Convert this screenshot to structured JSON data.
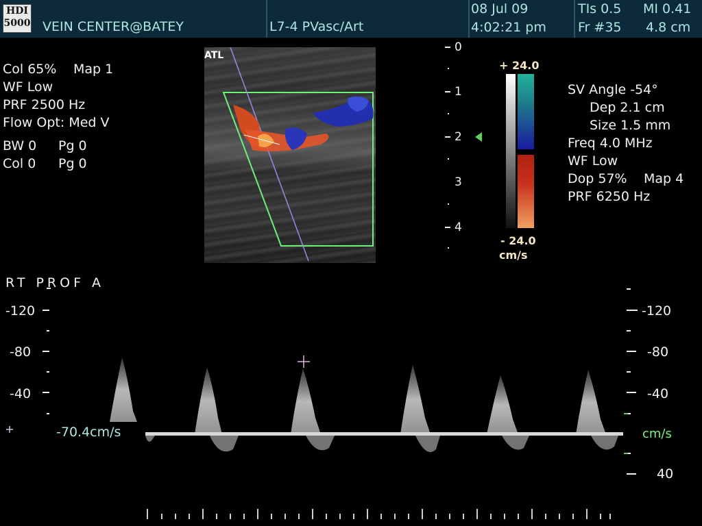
{
  "header": {
    "logo_line1": "HDI",
    "logo_line2": "5000",
    "facility": "VEIN CENTER@BATEY",
    "probe": "L7-4 PVasc/Art",
    "date": "08 Jul 09",
    "time": "4:02:21 pm",
    "tis": "TIs 0.5",
    "mi": "MI 0.41",
    "frame": "Fr #35",
    "depth": "4.8 cm"
  },
  "color_settings": {
    "col": "Col 65%",
    "map": "Map 1",
    "wf": "WF Low",
    "prf": "PRF 2500  Hz",
    "flow_opt": "Flow Opt: Med V",
    "bw": "BW 0",
    "pg1": "Pg 0",
    "col0": "Col 0",
    "pg2": "Pg 0"
  },
  "image": {
    "atl_label": "ATL"
  },
  "depth_scale": {
    "labels": [
      "0",
      "1",
      "2",
      "3",
      "4"
    ]
  },
  "color_bar": {
    "top": "+ 24.0",
    "bottom": "- 24.0",
    "unit": "cm/s",
    "colors": {
      "teal": "#22b39a",
      "blue": "#1a1aa0",
      "red": "#c8321e",
      "orange": "#f0a060"
    }
  },
  "doppler_settings": {
    "sv_angle": "SV Angle -54°",
    "dep": "Dep 2.1  cm",
    "size": "Size 1.5  mm",
    "freq": "Freq 4.0  MHz",
    "wf": "WF Low",
    "dop": "Dop 57%",
    "map": "Map 4",
    "prf": "PRF 6250  Hz"
  },
  "spectral": {
    "label": "RT  PROF  A",
    "left_scale": [
      "-120",
      "-80",
      "-40"
    ],
    "right_scale": [
      "-120",
      "-80",
      "-40"
    ],
    "bottom_right": "40",
    "unit": "cm/s",
    "measurement": "-70.4cm/s",
    "peak_count": 6
  }
}
